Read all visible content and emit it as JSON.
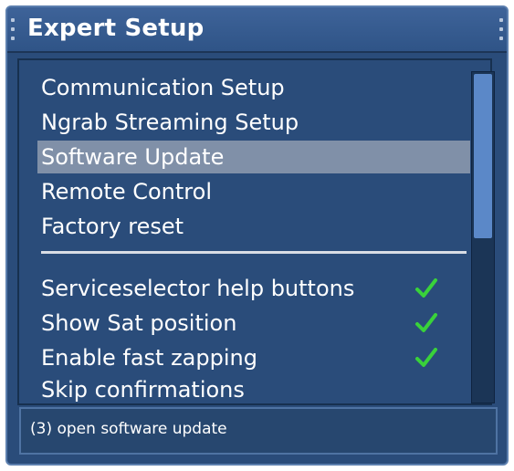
{
  "window": {
    "title": "Expert Setup"
  },
  "menu": {
    "items": [
      {
        "label": "Communication Setup"
      },
      {
        "label": "Ngrab Streaming Setup"
      },
      {
        "label": "Software Update"
      },
      {
        "label": "Remote Control"
      },
      {
        "label": "Factory reset"
      }
    ],
    "selected_label": "Software Update",
    "options": [
      {
        "label": "Serviceselector help buttons",
        "enabled": true
      },
      {
        "label": "Show Sat position",
        "enabled": true
      },
      {
        "label": "Enable fast zapping",
        "enabled": true
      },
      {
        "label": "Skip confirmations",
        "enabled": false
      }
    ]
  },
  "status": {
    "text": "(3) open software update"
  },
  "colors": {
    "background": "#2a4c7a",
    "selection": "#8090a8",
    "check": "#39d23a",
    "scroll_thumb": "#5b88c8"
  },
  "icons": {
    "check": "check-icon"
  }
}
